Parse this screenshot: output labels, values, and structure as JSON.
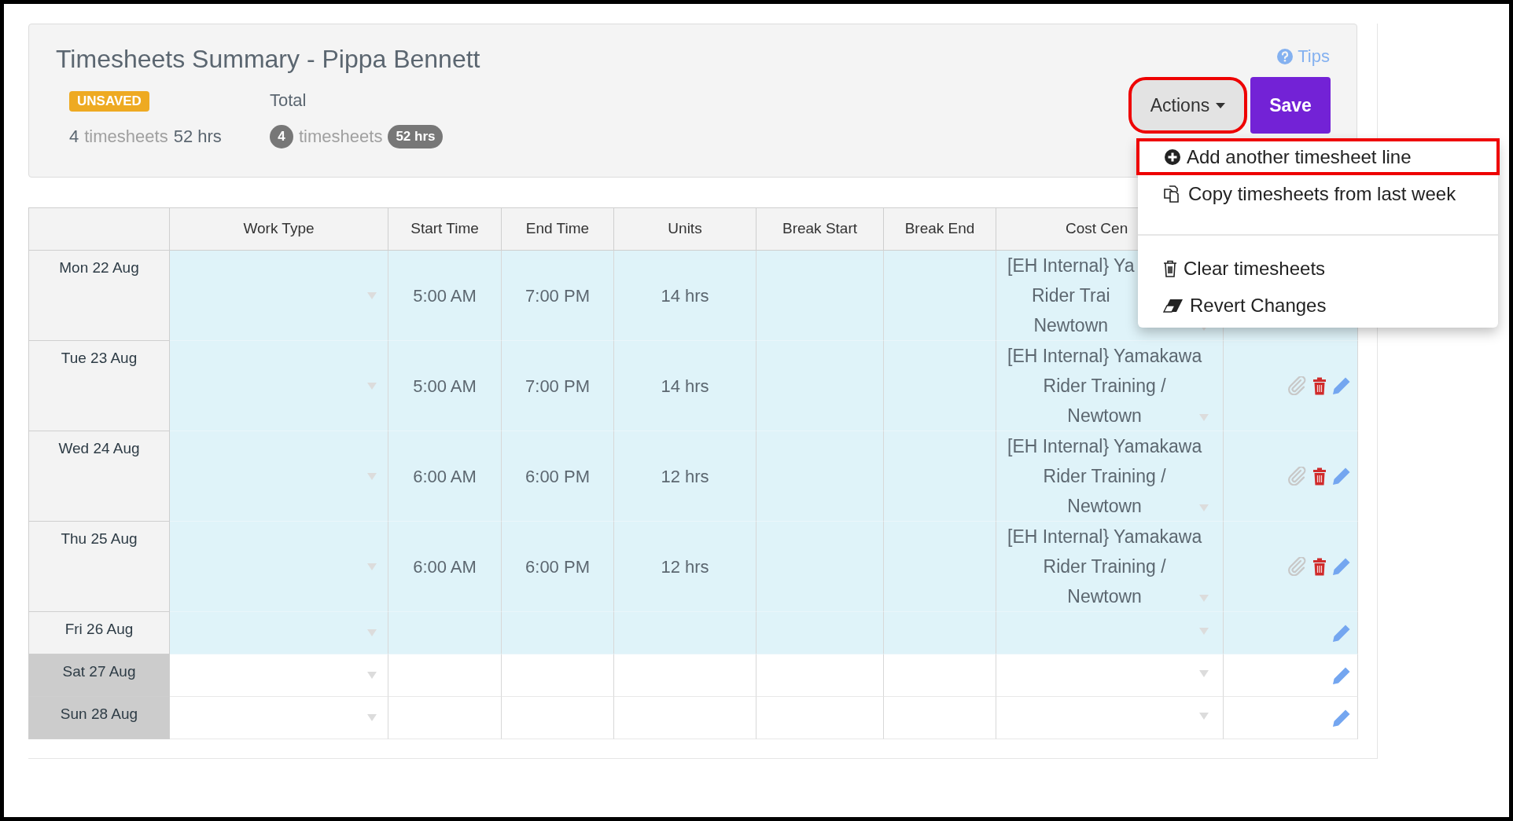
{
  "header": {
    "title": "Timesheets Summary - Pippa Bennett",
    "status_badge": "UNSAVED",
    "summary": {
      "count": "4",
      "count_label": "timesheets",
      "hours": "52 hrs"
    },
    "total": {
      "label": "Total",
      "count": "4",
      "count_label": "timesheets",
      "hours": "52 hrs"
    },
    "tips": "Tips",
    "actions_button": {
      "label": "Actions",
      "highlighted": true
    },
    "save_button": "Save"
  },
  "actions_menu": {
    "groups": [
      [
        {
          "kind": "add",
          "label": "Add another timesheet line",
          "highlighted": true
        },
        {
          "kind": "copy",
          "label": "Copy timesheets from last week",
          "highlighted": false
        }
      ],
      [
        {
          "kind": "clear",
          "label": "Clear timesheets",
          "highlighted": false
        },
        {
          "kind": "revert",
          "label": "Revert Changes",
          "highlighted": false
        }
      ]
    ]
  },
  "table": {
    "columns": [
      "Work Type",
      "Start Time",
      "End Time",
      "Units",
      "Break Start",
      "Break End",
      "Cost Cen"
    ],
    "rows": [
      {
        "date": "Mon 22 Aug",
        "weekend": false,
        "start": "5:00 AM",
        "end": "7:00 PM",
        "units": "14 hrs",
        "cost_centre": [
          "[EH Internal} Ya",
          "Rider Trai",
          "Newtown"
        ]
      },
      {
        "date": "Tue 23 Aug",
        "weekend": false,
        "start": "5:00 AM",
        "end": "7:00 PM",
        "units": "14 hrs",
        "cost_centre": [
          "[EH Internal} Yamakawa",
          "Rider Training /",
          "Newtown"
        ],
        "has_entry": true
      },
      {
        "date": "Wed 24 Aug",
        "weekend": false,
        "start": "6:00 AM",
        "end": "6:00 PM",
        "units": "12 hrs",
        "cost_centre": [
          "[EH Internal} Yamakawa",
          "Rider Training /",
          "Newtown"
        ],
        "has_entry": true
      },
      {
        "date": "Thu 25 Aug",
        "weekend": false,
        "start": "6:00 AM",
        "end": "6:00 PM",
        "units": "12 hrs",
        "cost_centre": [
          "[EH Internal} Yamakawa",
          "Rider Training /",
          "Newtown"
        ],
        "has_entry": true
      },
      {
        "date": "Fri 26 Aug",
        "weekend": false,
        "has_entry": false
      },
      {
        "date": "Sat 27 Aug",
        "weekend": true,
        "has_entry": false
      },
      {
        "date": "Sun 28 Aug",
        "weekend": true,
        "has_entry": false
      }
    ]
  }
}
